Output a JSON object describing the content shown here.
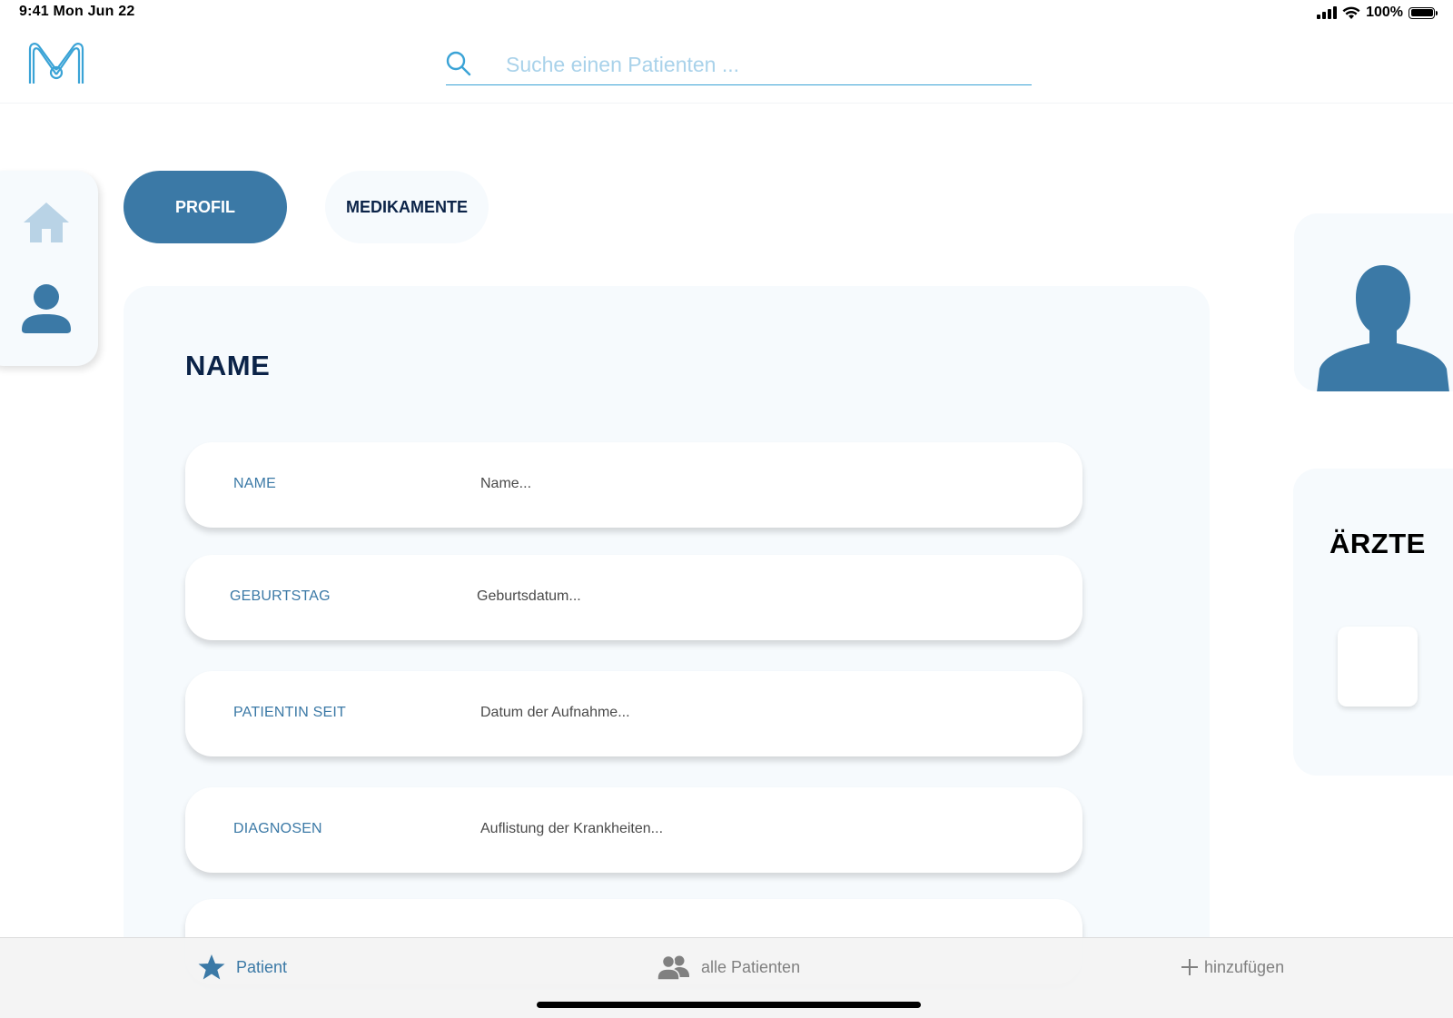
{
  "status_bar": {
    "time": "9:41  Mon Jun 22",
    "battery": "100%",
    "icons": [
      "signal-icon",
      "wifi-icon",
      "battery-icon"
    ]
  },
  "header": {
    "logo_icon": "m-logo-icon",
    "search": {
      "placeholder": "Suche einen Patienten ...",
      "value": "",
      "icon": "search-icon"
    }
  },
  "sidebar": {
    "items": [
      {
        "icon": "home-icon",
        "active": false
      },
      {
        "icon": "user-icon",
        "active": true
      }
    ]
  },
  "tabs": [
    {
      "label": "PROFIL",
      "active": true
    },
    {
      "label": "MEDIKAMENTE",
      "active": false
    }
  ],
  "profile": {
    "title": "NAME",
    "fields": [
      {
        "label": "NAME",
        "placeholder": "Name..."
      },
      {
        "label": "GEBURTSTAG",
        "placeholder": "Geburtsdatum..."
      },
      {
        "label": "PATIENTIN SEIT",
        "placeholder": "Datum der Aufnahme..."
      },
      {
        "label": "DIAGNOSEN",
        "placeholder": "Auflistung der Krankheiten..."
      }
    ]
  },
  "right_panel": {
    "avatar_icon": "person-silhouette-icon",
    "doctors_title": "ÄRZTE"
  },
  "tab_bar": {
    "items": [
      {
        "label": "Patient",
        "icon": "star-icon",
        "active": true
      },
      {
        "label": "alle Patienten",
        "icon": "people-icon",
        "active": false
      },
      {
        "label": "hinzufügen",
        "icon": "plus-icon",
        "active": false
      }
    ]
  },
  "colors": {
    "primary": "#3b79a6",
    "navy_text": "#0b2348",
    "panel_bg": "#f6fafd",
    "search_accent": "#3aa3d6",
    "inactive_icon": "#b9d3e6",
    "tab_bar_inactive": "#808080"
  }
}
